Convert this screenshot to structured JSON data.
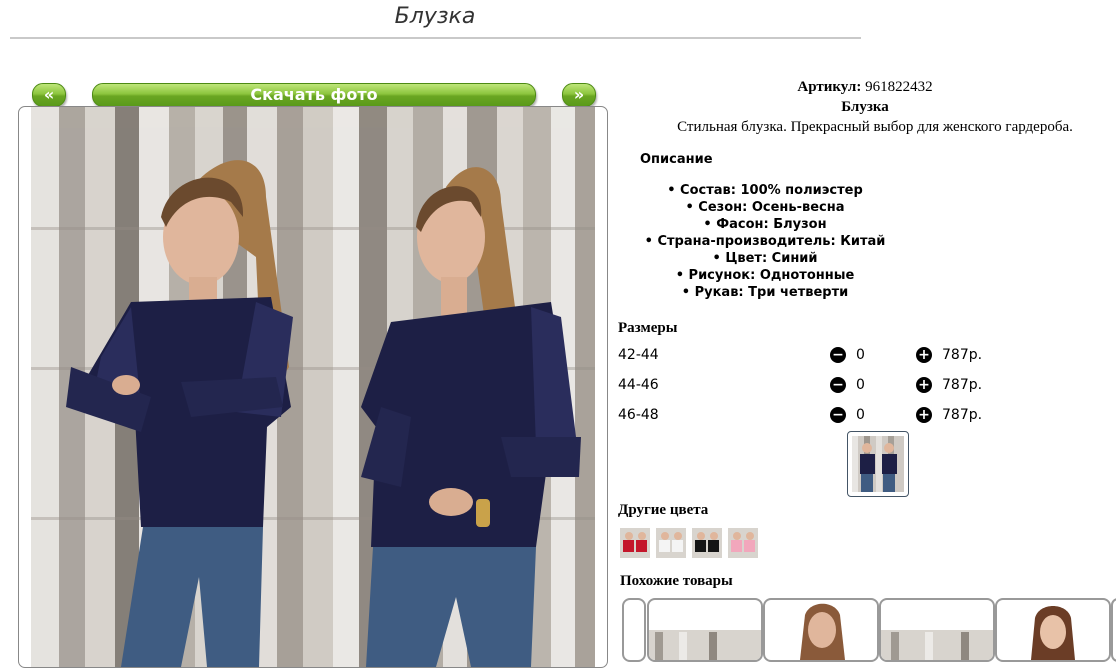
{
  "page": {
    "title": "Блузка"
  },
  "gallery": {
    "prev_label": "«",
    "next_label": "»",
    "download_label": "Скачать фото"
  },
  "product": {
    "article_label": "Артикул:",
    "article_value": "961822432",
    "name": "Блузка",
    "short_description": "Стильная блузка. Прекрасный выбор для женского гардероба."
  },
  "description": {
    "heading": "Описание",
    "items": [
      "Состав: 100% полиэстер",
      "Сезон: Осень-весна",
      "Фасон: Блузон",
      "Страна-производитель: Китай",
      "Цвет: Синий",
      "Рисунок: Однотонные",
      "Рукав: Три четверти"
    ]
  },
  "sizes": {
    "heading": "Размеры",
    "rows": [
      {
        "label": "42-44",
        "qty": "0",
        "price": "787р."
      },
      {
        "label": "44-46",
        "qty": "0",
        "price": "787р."
      },
      {
        "label": "46-48",
        "qty": "0",
        "price": "787р."
      }
    ]
  },
  "other_colors": {
    "heading": "Другие цвета",
    "swatches": [
      "red",
      "white",
      "black",
      "pink"
    ]
  },
  "similar": {
    "heading": "Похожие товары"
  },
  "icons": {
    "minus": "minus-circle-icon",
    "plus": "plus-circle-icon"
  },
  "colors": {
    "button_green": "#6aa622",
    "blouse_navy": "#1d1f45"
  }
}
